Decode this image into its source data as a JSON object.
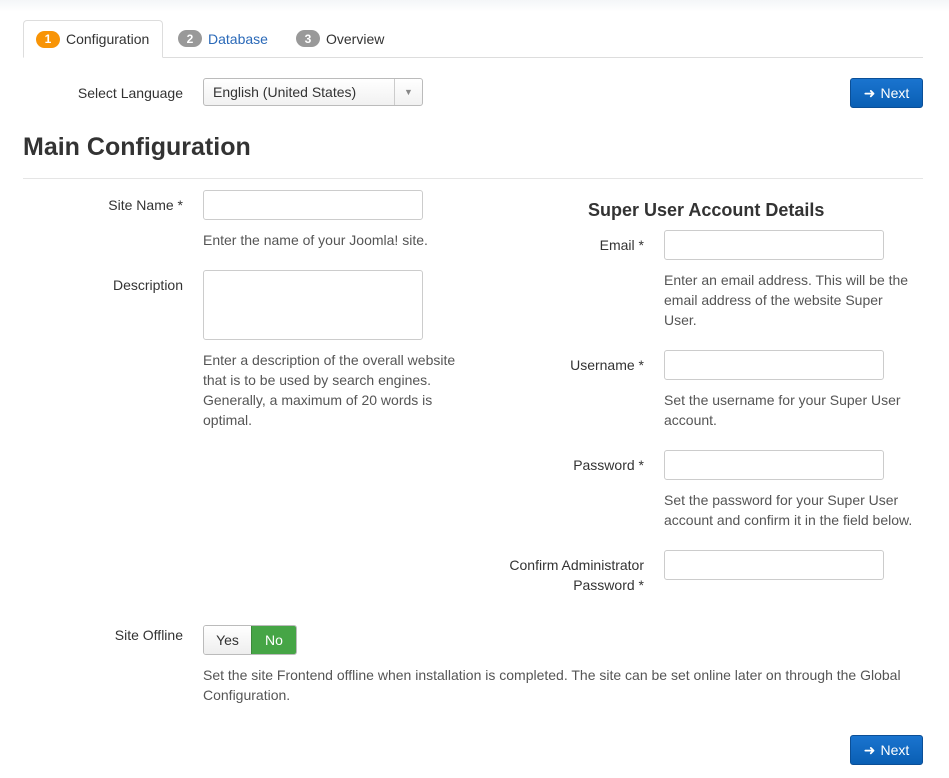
{
  "tabs": [
    {
      "num": "1",
      "label": "Configuration"
    },
    {
      "num": "2",
      "label": "Database"
    },
    {
      "num": "3",
      "label": "Overview"
    }
  ],
  "language": {
    "label": "Select Language",
    "value": "English (United States)"
  },
  "next_label": "Next",
  "main_title": "Main Configuration",
  "site_name": {
    "label": "Site Name *",
    "value": "",
    "help": "Enter the name of your Joomla! site."
  },
  "description": {
    "label": "Description",
    "value": "",
    "help_lines": [
      "Enter a description of the overall website",
      "that is to be used by search engines.",
      "Generally, a maximum of 20 words is",
      "optimal."
    ]
  },
  "super_user": {
    "title": "Super User Account Details",
    "email": {
      "label": "Email *",
      "value": "",
      "help_lines": [
        "Enter an email address. This will be the",
        "email address of the website Super",
        "User."
      ]
    },
    "username": {
      "label": "Username *",
      "value": "",
      "help_lines": [
        "Set the username for your Super User",
        "account."
      ]
    },
    "password": {
      "label": "Password *",
      "value": "",
      "help_lines": [
        "Set the password for your Super User",
        "account and confirm it in the field below."
      ]
    },
    "confirm": {
      "label_lines": [
        "Confirm Administrator",
        "Password *"
      ],
      "value": ""
    }
  },
  "site_offline": {
    "label": "Site Offline",
    "yes": "Yes",
    "no": "No",
    "selected": "No",
    "help_lines": [
      "Set the site Frontend offline when installation is completed. The site can be set online later on through the Global",
      "Configuration."
    ]
  },
  "colors": {
    "primary": "#0a5fb4",
    "badge_active": "#f89406",
    "badge": "#999999",
    "toggle_on": "#46a546",
    "link": "#2a69b8"
  }
}
